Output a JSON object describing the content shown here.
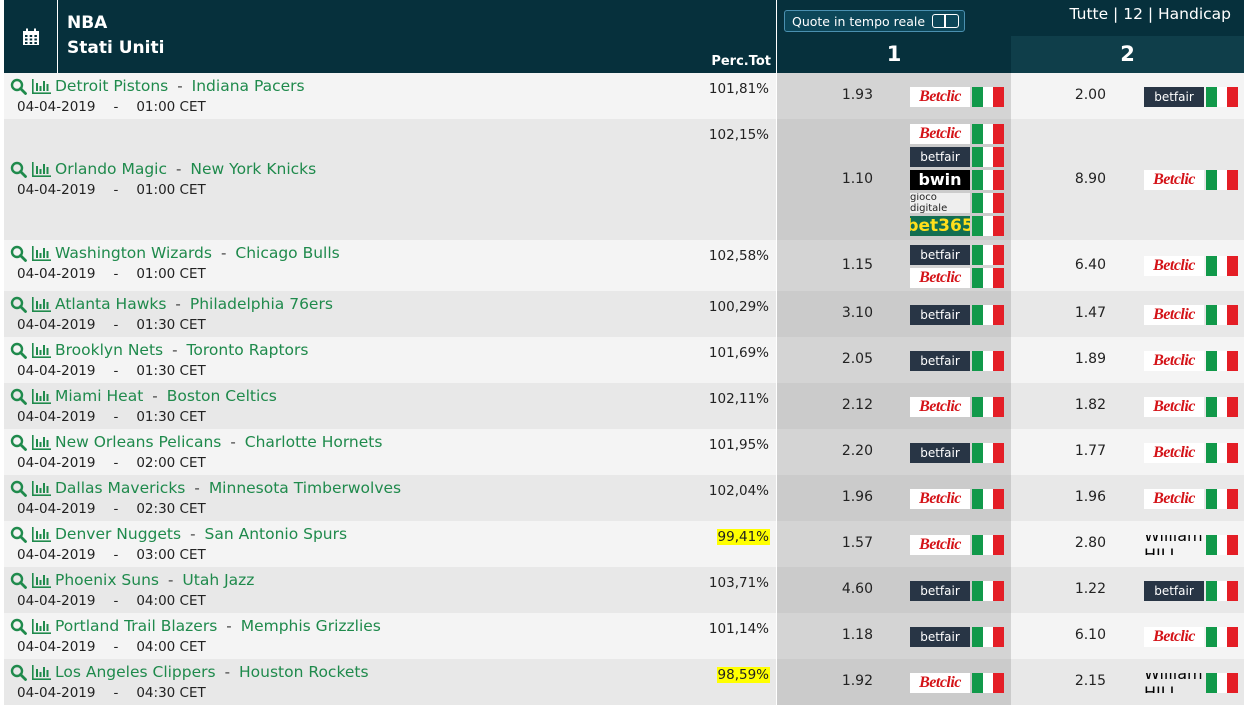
{
  "header": {
    "league": "NBA",
    "country": "Stati Uniti",
    "perc_label": "Perc.Tot",
    "live_label": "Quote in tempo reale",
    "filters": "Tutte | 12 | Handicap",
    "col1": "1",
    "col2": "2"
  },
  "bookmakers": {
    "betclic": "Betclic",
    "betfair": "betfair",
    "bwin": "bwin",
    "gioco": "gioco digitale",
    "bet365": "bet365",
    "william": "William HILL"
  },
  "matches": [
    {
      "home": "Detroit Pistons",
      "away": "Indiana Pacers",
      "date": "04-04-2019",
      "time": "01:00 CET",
      "perc": "101,81%",
      "highlight": false,
      "o1": "1.93",
      "b1": [
        "betclic"
      ],
      "o2": "2.00",
      "b2": [
        "betfair"
      ]
    },
    {
      "home": "Orlando Magic",
      "away": "New York Knicks",
      "date": "04-04-2019",
      "time": "01:00 CET",
      "perc": "102,15%",
      "highlight": false,
      "o1": "1.10",
      "b1": [
        "betclic",
        "betfair",
        "bwin",
        "gioco",
        "bet365"
      ],
      "o2": "8.90",
      "b2": [
        "betclic"
      ]
    },
    {
      "home": "Washington Wizards",
      "away": "Chicago Bulls",
      "date": "04-04-2019",
      "time": "01:00 CET",
      "perc": "102,58%",
      "highlight": false,
      "o1": "1.15",
      "b1": [
        "betfair",
        "betclic"
      ],
      "o2": "6.40",
      "b2": [
        "betclic"
      ]
    },
    {
      "home": "Atlanta Hawks",
      "away": "Philadelphia 76ers",
      "date": "04-04-2019",
      "time": "01:30 CET",
      "perc": "100,29%",
      "highlight": false,
      "o1": "3.10",
      "b1": [
        "betfair"
      ],
      "o2": "1.47",
      "b2": [
        "betclic"
      ]
    },
    {
      "home": "Brooklyn Nets",
      "away": "Toronto Raptors",
      "date": "04-04-2019",
      "time": "01:30 CET",
      "perc": "101,69%",
      "highlight": false,
      "o1": "2.05",
      "b1": [
        "betfair"
      ],
      "o2": "1.89",
      "b2": [
        "betclic"
      ]
    },
    {
      "home": "Miami Heat",
      "away": "Boston Celtics",
      "date": "04-04-2019",
      "time": "01:30 CET",
      "perc": "102,11%",
      "highlight": false,
      "o1": "2.12",
      "b1": [
        "betclic"
      ],
      "o2": "1.82",
      "b2": [
        "betclic"
      ]
    },
    {
      "home": "New Orleans Pelicans",
      "away": "Charlotte Hornets",
      "date": "04-04-2019",
      "time": "02:00 CET",
      "perc": "101,95%",
      "highlight": false,
      "o1": "2.20",
      "b1": [
        "betfair"
      ],
      "o2": "1.77",
      "b2": [
        "betclic"
      ]
    },
    {
      "home": "Dallas Mavericks",
      "away": "Minnesota Timberwolves",
      "date": "04-04-2019",
      "time": "02:30 CET",
      "perc": "102,04%",
      "highlight": false,
      "o1": "1.96",
      "b1": [
        "betclic"
      ],
      "o2": "1.96",
      "b2": [
        "betclic"
      ]
    },
    {
      "home": "Denver Nuggets",
      "away": "San Antonio Spurs",
      "date": "04-04-2019",
      "time": "03:00 CET",
      "perc": "99,41%",
      "highlight": true,
      "o1": "1.57",
      "b1": [
        "betclic"
      ],
      "o2": "2.80",
      "b2": [
        "william"
      ]
    },
    {
      "home": "Phoenix Suns",
      "away": "Utah Jazz",
      "date": "04-04-2019",
      "time": "04:00 CET",
      "perc": "103,71%",
      "highlight": false,
      "o1": "4.60",
      "b1": [
        "betfair"
      ],
      "o2": "1.22",
      "b2": [
        "betfair"
      ]
    },
    {
      "home": "Portland Trail Blazers",
      "away": "Memphis Grizzlies",
      "date": "04-04-2019",
      "time": "04:00 CET",
      "perc": "101,14%",
      "highlight": false,
      "o1": "1.18",
      "b1": [
        "betfair"
      ],
      "o2": "6.10",
      "b2": [
        "betclic"
      ]
    },
    {
      "home": "Los Angeles Clippers",
      "away": "Houston Rockets",
      "date": "04-04-2019",
      "time": "04:30 CET",
      "perc": "98,59%",
      "highlight": true,
      "o1": "1.92",
      "b1": [
        "betclic"
      ],
      "o2": "2.15",
      "b2": [
        "william"
      ]
    }
  ]
}
